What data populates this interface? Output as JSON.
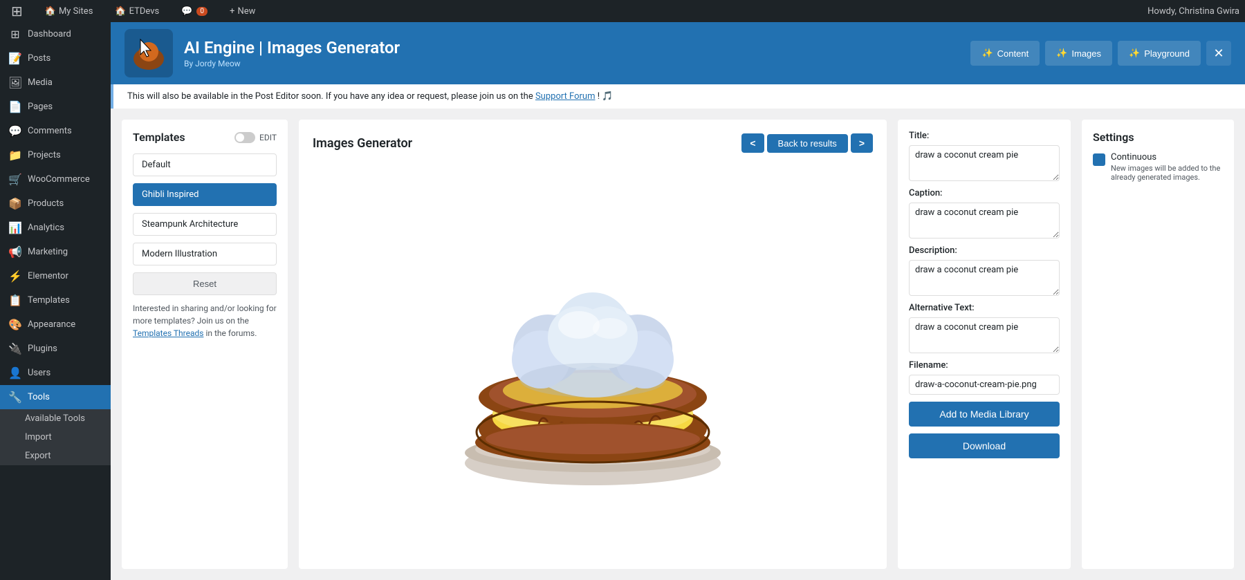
{
  "adminbar": {
    "logo": "W",
    "items": [
      {
        "label": "My Sites",
        "icon": "🏠"
      },
      {
        "label": "ETDevs",
        "icon": "🏠"
      },
      {
        "label": "0",
        "icon": "💬"
      },
      {
        "label": "New",
        "icon": "+"
      }
    ],
    "user": "Howdy, Christina Gwira"
  },
  "sidebar": {
    "items": [
      {
        "label": "Dashboard",
        "icon": "⊞",
        "active": false
      },
      {
        "label": "Posts",
        "icon": "📝",
        "active": false
      },
      {
        "label": "Media",
        "icon": "🖼",
        "active": false
      },
      {
        "label": "Pages",
        "icon": "📄",
        "active": false
      },
      {
        "label": "Comments",
        "icon": "💬",
        "active": false
      },
      {
        "label": "Projects",
        "icon": "📁",
        "active": false
      },
      {
        "label": "WooCommerce",
        "icon": "🛒",
        "active": false
      },
      {
        "label": "Products",
        "icon": "📦",
        "active": false
      },
      {
        "label": "Analytics",
        "icon": "📊",
        "active": false
      },
      {
        "label": "Marketing",
        "icon": "📢",
        "active": false
      },
      {
        "label": "Elementor",
        "icon": "⚡",
        "active": false
      },
      {
        "label": "Templates",
        "icon": "📋",
        "active": false
      },
      {
        "label": "Appearance",
        "icon": "🎨",
        "active": false
      },
      {
        "label": "Plugins",
        "icon": "🔌",
        "active": false
      },
      {
        "label": "Users",
        "icon": "👤",
        "active": false
      },
      {
        "label": "Tools",
        "icon": "🔧",
        "active": true
      }
    ],
    "submenu": [
      {
        "label": "Available Tools",
        "active": false
      },
      {
        "label": "Import",
        "active": false
      },
      {
        "label": "Export",
        "active": false
      }
    ]
  },
  "header": {
    "title": "AI Engine | Images Generator",
    "by": "By Jordy Meow",
    "nav": [
      {
        "label": "Content",
        "icon": "✨"
      },
      {
        "label": "Images",
        "icon": "✨"
      },
      {
        "label": "Playground",
        "icon": "✨"
      }
    ],
    "close_icon": "✕"
  },
  "notice": {
    "text": "This will also be available in the Post Editor soon. If you have any idea or request, please join us on the ",
    "link_label": "Support Forum",
    "suffix": "! 🎵"
  },
  "templates": {
    "title": "Templates",
    "edit_label": "EDIT",
    "items": [
      {
        "label": "Default",
        "active": false
      },
      {
        "label": "Ghibli Inspired",
        "active": true
      },
      {
        "label": "Steampunk Architecture",
        "active": false
      },
      {
        "label": "Modern Illustration",
        "active": false
      }
    ],
    "reset_label": "Reset",
    "footer_text": "Interested in sharing and/or looking for more templates? Join us on the ",
    "footer_link": "Templates Threads",
    "footer_suffix": " in the forums."
  },
  "generator": {
    "title": "Images Generator",
    "nav_prev": "<",
    "nav_back": "Back to results",
    "nav_next": ">"
  },
  "fields": {
    "title_label": "Title:",
    "title_value": "draw a coconut cream pie",
    "caption_label": "Caption:",
    "caption_value": "draw a coconut cream pie",
    "description_label": "Description:",
    "description_value": "draw a coconut cream pie",
    "alt_label": "Alternative Text:",
    "alt_value": "draw a coconut cream pie",
    "filename_label": "Filename:",
    "filename_value": "draw-a-coconut-cream-pie.png",
    "add_to_library_label": "Add to Media Library",
    "download_label": "Download"
  },
  "settings": {
    "title": "Settings",
    "continuous_label": "Continuous",
    "continuous_subtext": "New images will be added to the already generated images."
  },
  "colors": {
    "accent": "#2271b1",
    "header_bg": "#2271b1",
    "sidebar_bg": "#1d2327",
    "active_menu": "#2271b1"
  }
}
